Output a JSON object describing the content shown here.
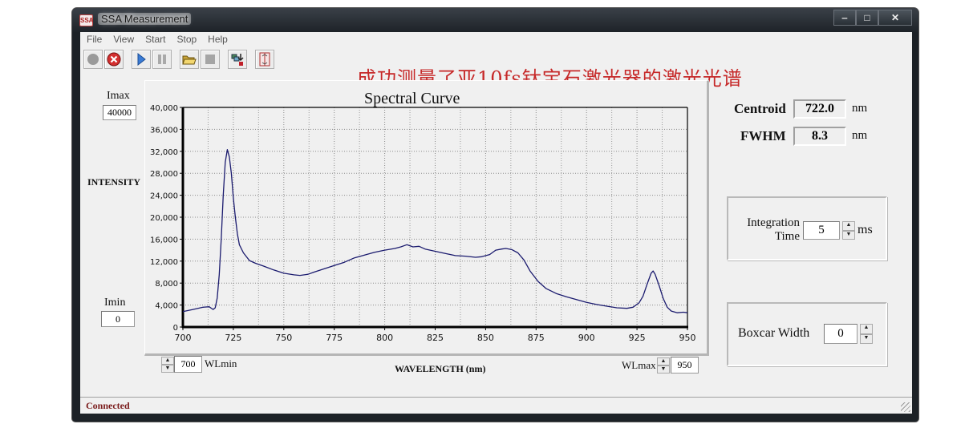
{
  "window": {
    "title": "SSA Measurement",
    "app_icon": "SSA",
    "controls": {
      "minimize": "‒",
      "maximize": "□",
      "close": "✕"
    }
  },
  "menu": [
    "File",
    "View",
    "Start",
    "Stop",
    "Help"
  ],
  "toolbar": [
    {
      "name": "record-icon"
    },
    {
      "name": "cancel-icon"
    },
    {
      "name": "play-icon"
    },
    {
      "name": "pause-icon"
    },
    {
      "name": "open-folder-icon"
    },
    {
      "name": "stop-icon"
    },
    {
      "name": "export-icon"
    },
    {
      "name": "book-icon"
    }
  ],
  "annotation": "成功测量了亚10fs钛宝石激光器的激光光谱",
  "left_panel": {
    "imax_label": "Imax",
    "imax_value": "40000",
    "intensity_label": "INTENSITY",
    "imin_label": "Imin",
    "imin_value": "0"
  },
  "bottom_controls": {
    "wlmin_value": "700",
    "wlmin_label": "WLmin",
    "xaxis_label": "WAVELENGTH (nm)",
    "wlmax_label": "WLmax",
    "wlmax_value": "950"
  },
  "results": {
    "centroid_label": "Centroid",
    "centroid_value": "722.0",
    "centroid_unit": "nm",
    "fwhm_label": "FWHM",
    "fwhm_value": "8.3",
    "fwhm_unit": "nm"
  },
  "integration": {
    "label_line1": "Integration",
    "label_line2": "Time",
    "value": "5",
    "unit": "ms"
  },
  "boxcar": {
    "label": "Boxcar Width",
    "value": "0"
  },
  "status": "Connected",
  "colors": {
    "curve": "#1a1a6e",
    "annotation": "#c62828",
    "status": "#7a1c1c"
  },
  "chart_data": {
    "type": "line",
    "title": "Spectral Curve",
    "xlabel": "WAVELENGTH (nm)",
    "ylabel": "INTENSITY",
    "xlim": [
      700,
      950
    ],
    "ylim": [
      0,
      40000
    ],
    "xticks": [
      "700",
      "725",
      "750",
      "775",
      "800",
      "825",
      "850",
      "875",
      "900",
      "925",
      "950"
    ],
    "yticks": [
      "0",
      "4,000",
      "8,000",
      "12,000",
      "16,000",
      "20,000",
      "24,000",
      "28,000",
      "32,000",
      "36,000",
      "40,000"
    ],
    "grid": true,
    "series": [
      {
        "name": "spectrum",
        "x": [
          700,
          705,
          710,
          713,
          715,
          716,
          717,
          718,
          719,
          720,
          721,
          722,
          723,
          724,
          725,
          726,
          727,
          728,
          730,
          733,
          736,
          740,
          745,
          750,
          755,
          758,
          762,
          765,
          770,
          775,
          780,
          785,
          790,
          795,
          800,
          805,
          808,
          811,
          814,
          817,
          820,
          825,
          830,
          835,
          840,
          845,
          848,
          852,
          855,
          858,
          860,
          863,
          866,
          869,
          872,
          876,
          880,
          885,
          890,
          895,
          900,
          905,
          910,
          915,
          920,
          923,
          926,
          928,
          930,
          932,
          933,
          934,
          936,
          938,
          940,
          942,
          945,
          948,
          950
        ],
        "y": [
          2800,
          3200,
          3600,
          3700,
          3200,
          3500,
          5300,
          9500,
          16000,
          24000,
          30000,
          32300,
          31000,
          28000,
          23500,
          20000,
          17000,
          15000,
          13500,
          12100,
          11600,
          11100,
          10400,
          9800,
          9500,
          9400,
          9600,
          10000,
          10600,
          11200,
          11800,
          12600,
          13100,
          13600,
          14000,
          14300,
          14600,
          15000,
          14600,
          14700,
          14200,
          13800,
          13400,
          13000,
          12900,
          12700,
          12800,
          13200,
          14000,
          14200,
          14300,
          14100,
          13500,
          12200,
          10200,
          8300,
          7000,
          6100,
          5500,
          5000,
          4500,
          4100,
          3800,
          3500,
          3400,
          3600,
          4400,
          5600,
          7800,
          9800,
          10200,
          9600,
          7500,
          5200,
          3600,
          2900,
          2600,
          2700,
          2600
        ]
      }
    ]
  }
}
